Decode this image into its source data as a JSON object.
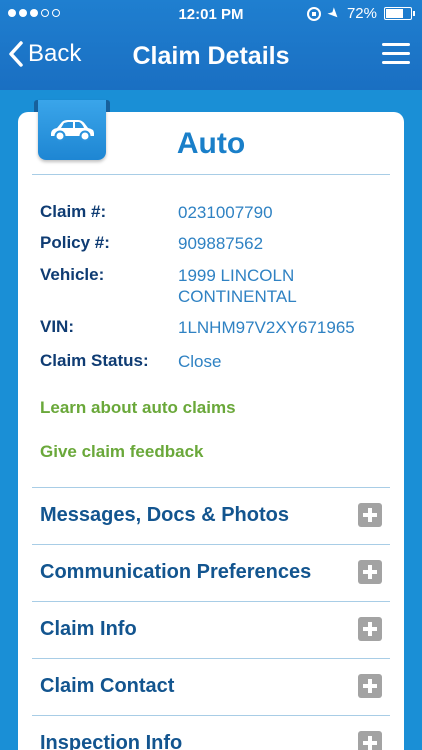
{
  "status_bar": {
    "time": "12:01 PM",
    "battery": "72%",
    "battery_level": 0.72,
    "signal_dots_filled": 3,
    "signal_dots_total": 5
  },
  "nav": {
    "back_label": "Back",
    "title": "Claim Details",
    "menu_icon": "hamburger-menu-icon"
  },
  "card": {
    "title": "Auto",
    "badge_icon": "car-icon",
    "details": [
      {
        "label": "Claim #:",
        "value": "0231007790"
      },
      {
        "label": "Policy #:",
        "value": "909887562"
      },
      {
        "label": "Vehicle:",
        "value": "1999 LINCOLN CONTINENTAL"
      },
      {
        "label": "VIN:",
        "value": "1LNHM97V2XY671965"
      },
      {
        "label": "Claim Status:",
        "value": "Close"
      }
    ],
    "links": [
      "Learn about auto claims",
      "Give claim feedback"
    ],
    "sections": [
      "Messages, Docs & Photos",
      "Communication Preferences",
      "Claim Info",
      "Claim Contact",
      "Inspection Info"
    ]
  },
  "colors": {
    "header_blue": "#1a6fc2",
    "background_blue": "#1a8fd6",
    "title_blue": "#1a7fc9",
    "label_navy": "#0f3c73",
    "value_blue": "#2f82c3",
    "link_green": "#6aa83a"
  }
}
